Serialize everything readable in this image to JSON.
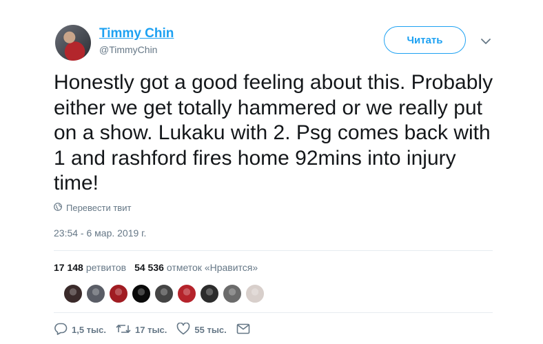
{
  "author": {
    "display_name": "Timmy Chin",
    "handle": "@TimmyChin"
  },
  "follow_label": "Читать",
  "tweet_text": "Honestly got a good feeling about this. Probably either we get totally hammered or we really put on a show. Lukaku with 2. Psg comes back with 1 and rashford fires home 92mins into injury time!",
  "translate_label": "Перевести твит",
  "timestamp": "23:54 - 6 мар. 2019 г.",
  "stats": {
    "retweets_count": "17 148",
    "retweets_label": "ретвитов",
    "likes_count": "54 536",
    "likes_label": "отметок «Нравится»"
  },
  "likers": [
    {
      "color": "#3a2a2a"
    },
    {
      "color": "#5a5d66"
    },
    {
      "color": "#a01c22"
    },
    {
      "color": "#0a0a0a"
    },
    {
      "color": "#444444"
    },
    {
      "color": "#b5232b"
    },
    {
      "color": "#2c2c2c"
    },
    {
      "color": "#6b6b6b"
    },
    {
      "color": "#d8cfcb"
    }
  ],
  "actions": {
    "replies": "1,5 тыс.",
    "retweets": "17 тыс.",
    "likes": "55 тыс."
  },
  "colors": {
    "accent": "#1da1f2",
    "secondary_text": "#657786",
    "divider": "#e6ecf0"
  },
  "icons": {
    "reply": "speech-bubble",
    "retweet": "retweet-arrows",
    "like": "heart-outline",
    "dm": "envelope",
    "globe": "globe",
    "caret": "chevron-down"
  }
}
